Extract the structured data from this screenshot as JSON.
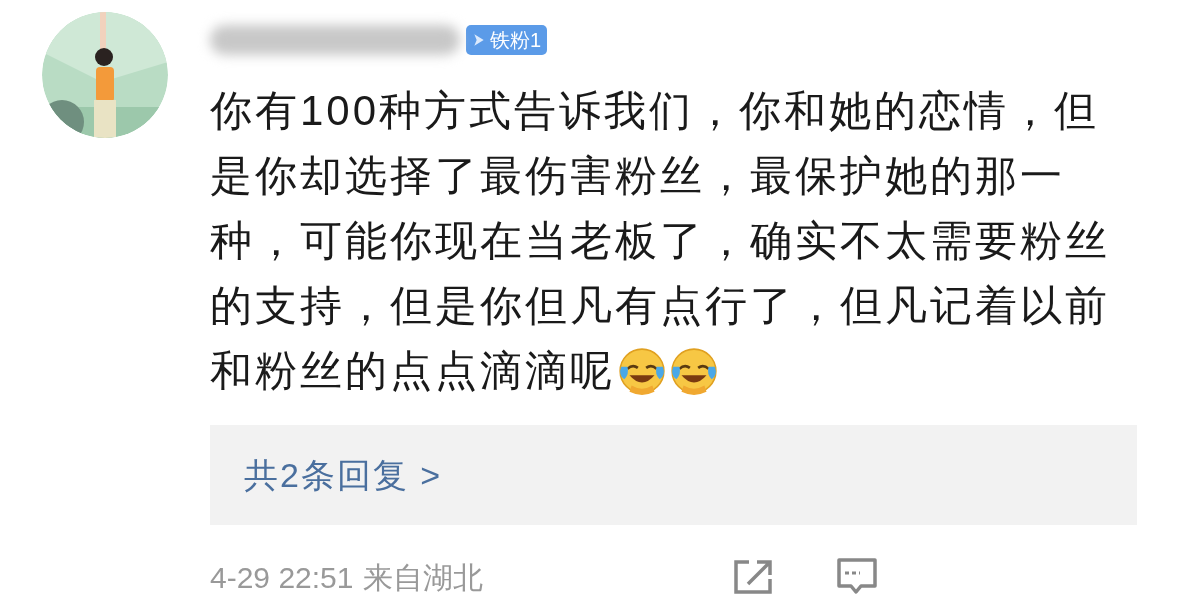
{
  "comment": {
    "badge": "铁粉1",
    "lines": [
      "你有100种方式告诉我们，你和她的恋情，但",
      "是你却选择了最伤害粉丝，最保护她的那一",
      "种，可能你现在当老板了，确实不太需要粉丝",
      "的支持，但是你但凡有点行了，但凡记着以前",
      "和粉丝的点点滴滴呢"
    ],
    "emojis": [
      {
        "kind": "laugh-cry"
      },
      {
        "kind": "laugh-cry"
      }
    ]
  },
  "replies": {
    "label": "共2条回复 >"
  },
  "footer": {
    "time": "4-29 22:51",
    "location": "来自湖北"
  }
}
